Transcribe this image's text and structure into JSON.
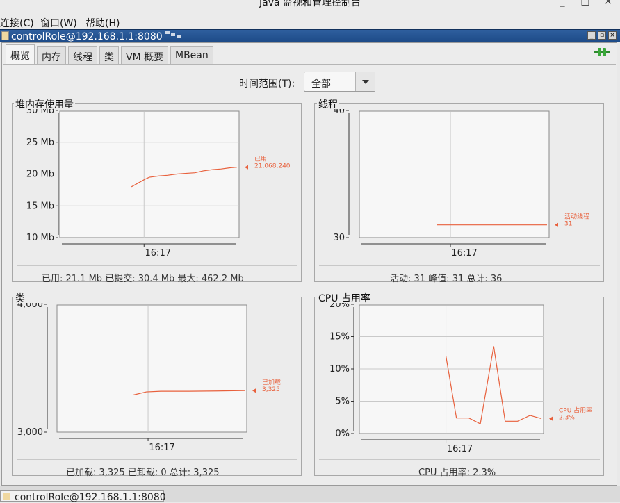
{
  "app_title": "Java 监视和管理控制台",
  "window_controls": {
    "minimize": "_",
    "maximize": "□",
    "close": "×"
  },
  "menu": [
    {
      "label": "连接(C)"
    },
    {
      "label": "窗口(W)"
    },
    {
      "label": "帮助(H)"
    }
  ],
  "connection_title": "controlRole@192.168.1.1:8080",
  "inner_controls": {
    "minimize": "_",
    "restore": "▫",
    "close": "×"
  },
  "tabs": [
    {
      "label": "概览",
      "active": true
    },
    {
      "label": "内存",
      "active": false
    },
    {
      "label": "线程",
      "active": false
    },
    {
      "label": "类",
      "active": false
    },
    {
      "label": "VM 概要",
      "active": false
    },
    {
      "label": "MBean",
      "active": false
    }
  ],
  "time_range": {
    "label": "时间范围(T):",
    "value": "全部"
  },
  "panels": {
    "heap": {
      "title": "堆内存使用量",
      "stats": "已用: 21.1 Mb    已提交: 30.4 Mb    最大: 462.2 Mb"
    },
    "threads": {
      "title": "线程",
      "stats": "活动: 31    峰值: 31    总计: 36"
    },
    "classes": {
      "title": "类",
      "stats": "已加载: 3,325    已卸载: 0    总计: 3,325"
    },
    "cpu": {
      "title": "CPU 占用率",
      "stats": "CPU 占用率: 2.3%"
    }
  },
  "colors": {
    "series": "#e8603c",
    "plot_bg": "#f7f7f7",
    "titlebar": "#1d4a87"
  },
  "chart_data": [
    {
      "type": "line",
      "name": "heap",
      "x_ticks": [
        "16:17"
      ],
      "y_ticks": [
        "10 Mb",
        "15 Mb",
        "20 Mb",
        "25 Mb",
        "30 Mb"
      ],
      "ylim": [
        10,
        30
      ],
      "x": [
        0.0,
        0.13,
        0.17,
        0.26,
        0.34,
        0.43,
        0.51,
        0.6,
        0.68,
        0.77,
        0.85,
        0.94,
        1.0
      ],
      "series": [
        {
          "name": "已用",
          "value_label": "21,068,240",
          "values": [
            18.0,
            19.2,
            19.5,
            19.7,
            19.8,
            20.0,
            20.1,
            20.2,
            20.5,
            20.7,
            20.8,
            21.0,
            21.07
          ]
        }
      ]
    },
    {
      "type": "line",
      "name": "threads",
      "x_ticks": [
        "16:17"
      ],
      "y_ticks": [
        "30",
        "40"
      ],
      "ylim": [
        30,
        40
      ],
      "x": [
        0.0,
        1.0
      ],
      "series": [
        {
          "name": "活动线程",
          "value_label": "31",
          "values": [
            31,
            31
          ]
        }
      ]
    },
    {
      "type": "line",
      "name": "classes",
      "x_ticks": [
        "16:17"
      ],
      "y_ticks": [
        "3,000",
        "4,000"
      ],
      "ylim": [
        3000,
        4000
      ],
      "x": [
        0.0,
        0.12,
        0.25,
        0.5,
        0.75,
        1.0
      ],
      "series": [
        {
          "name": "已加载",
          "value_label": "3,325",
          "values": [
            3290,
            3315,
            3320,
            3320,
            3322,
            3325
          ]
        }
      ]
    },
    {
      "type": "line",
      "name": "cpu",
      "x_ticks": [
        "16:17"
      ],
      "y_ticks": [
        "0%",
        "5%",
        "10%",
        "15%",
        "20%"
      ],
      "ylim": [
        0,
        20
      ],
      "x": [
        0.0,
        0.11,
        0.24,
        0.36,
        0.5,
        0.62,
        0.75,
        0.88,
        1.0
      ],
      "series": [
        {
          "name": "CPU 占用率",
          "value_label": "2.3%",
          "values": [
            12.0,
            2.4,
            2.4,
            1.5,
            13.5,
            1.9,
            1.9,
            2.8,
            2.3
          ]
        }
      ]
    }
  ]
}
